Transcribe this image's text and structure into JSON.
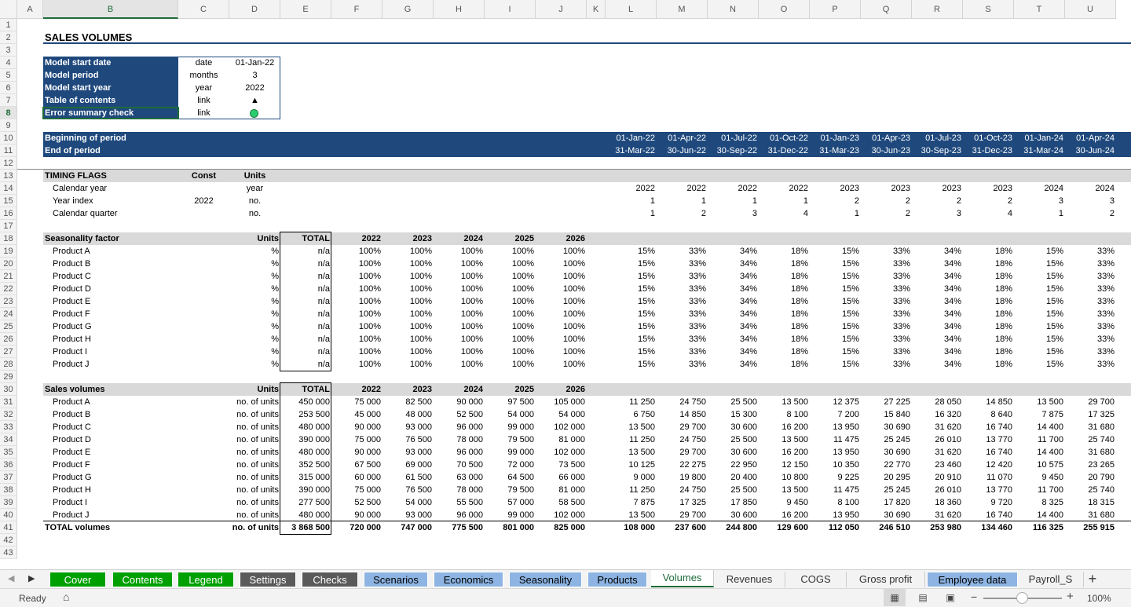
{
  "columns": [
    "A",
    "B",
    "C",
    "D",
    "E",
    "F",
    "G",
    "H",
    "I",
    "J",
    "K",
    "L",
    "M",
    "N",
    "O",
    "P",
    "Q",
    "R",
    "S",
    "T",
    "U"
  ],
  "rows": [
    "1",
    "2",
    "3",
    "4",
    "5",
    "6",
    "7",
    "8",
    "9",
    "10",
    "11",
    "12",
    "13",
    "14",
    "15",
    "16",
    "17",
    "18",
    "19",
    "20",
    "21",
    "22",
    "23",
    "24",
    "25",
    "26",
    "27",
    "28",
    "29",
    "30",
    "31",
    "32",
    "33",
    "34",
    "35",
    "36",
    "37",
    "38",
    "39",
    "40",
    "41",
    "42",
    "43"
  ],
  "title": "SALES VOLUMES",
  "model_info": [
    {
      "label": "Model start date",
      "unit": "date",
      "value": "01-Jan-22"
    },
    {
      "label": "Model period",
      "unit": "months",
      "value": "3"
    },
    {
      "label": "Model start year",
      "unit": "year",
      "value": "2022"
    },
    {
      "label": "Table of contents",
      "unit": "link",
      "value": "▲"
    },
    {
      "label": "Error summary check",
      "unit": "link",
      "value": ""
    }
  ],
  "period": {
    "begin_label": "Beginning of period",
    "end_label": "End of period",
    "begin": [
      "01-Jan-22",
      "01-Apr-22",
      "01-Jul-22",
      "01-Oct-22",
      "01-Jan-23",
      "01-Apr-23",
      "01-Jul-23",
      "01-Oct-23",
      "01-Jan-24",
      "01-Apr-24"
    ],
    "end": [
      "31-Mar-22",
      "30-Jun-22",
      "30-Sep-22",
      "31-Dec-22",
      "31-Mar-23",
      "30-Jun-23",
      "30-Sep-23",
      "31-Dec-23",
      "31-Mar-24",
      "30-Jun-24"
    ]
  },
  "timing": {
    "header": "TIMING FLAGS",
    "const_hdr": "Const",
    "units_hdr": "Units",
    "rows": [
      {
        "label": "Calendar year",
        "const": "",
        "units": "year",
        "values": [
          "2022",
          "2022",
          "2022",
          "2022",
          "2023",
          "2023",
          "2023",
          "2023",
          "2024",
          "2024"
        ]
      },
      {
        "label": "Year index",
        "const": "2022",
        "units": "no.",
        "values": [
          "1",
          "1",
          "1",
          "1",
          "2",
          "2",
          "2",
          "2",
          "3",
          "3"
        ]
      },
      {
        "label": "Calendar quarter",
        "const": "",
        "units": "no.",
        "values": [
          "1",
          "2",
          "3",
          "4",
          "1",
          "2",
          "3",
          "4",
          "1",
          "2"
        ]
      }
    ]
  },
  "seasonality": {
    "header": "Seasonality factor",
    "units_hdr": "Units",
    "total_hdr": "TOTAL",
    "years": [
      "2022",
      "2023",
      "2024",
      "2025",
      "2026"
    ],
    "products": [
      "Product A",
      "Product B",
      "Product C",
      "Product D",
      "Product E",
      "Product F",
      "Product G",
      "Product H",
      "Product I",
      "Product J"
    ],
    "units": "%",
    "total": "n/a",
    "annual": "100%",
    "quarters": [
      "15%",
      "33%",
      "34%",
      "18%",
      "15%",
      "33%",
      "34%",
      "18%",
      "15%",
      "33%"
    ]
  },
  "volumes": {
    "header": "Sales volumes",
    "units_hdr": "Units",
    "total_hdr": "TOTAL",
    "years": [
      "2022",
      "2023",
      "2024",
      "2025",
      "2026"
    ],
    "units": "no. of units",
    "rows": [
      {
        "label": "Product A",
        "total": "450 000",
        "annual": [
          "75 000",
          "82 500",
          "90 000",
          "97 500",
          "105 000"
        ],
        "q": [
          "11 250",
          "24 750",
          "25 500",
          "13 500",
          "12 375",
          "27 225",
          "28 050",
          "14 850",
          "13 500",
          "29 700"
        ]
      },
      {
        "label": "Product B",
        "total": "253 500",
        "annual": [
          "45 000",
          "48 000",
          "52 500",
          "54 000",
          "54 000"
        ],
        "q": [
          "6 750",
          "14 850",
          "15 300",
          "8 100",
          "7 200",
          "15 840",
          "16 320",
          "8 640",
          "7 875",
          "17 325"
        ]
      },
      {
        "label": "Product C",
        "total": "480 000",
        "annual": [
          "90 000",
          "93 000",
          "96 000",
          "99 000",
          "102 000"
        ],
        "q": [
          "13 500",
          "29 700",
          "30 600",
          "16 200",
          "13 950",
          "30 690",
          "31 620",
          "16 740",
          "14 400",
          "31 680"
        ]
      },
      {
        "label": "Product D",
        "total": "390 000",
        "annual": [
          "75 000",
          "76 500",
          "78 000",
          "79 500",
          "81 000"
        ],
        "q": [
          "11 250",
          "24 750",
          "25 500",
          "13 500",
          "11 475",
          "25 245",
          "26 010",
          "13 770",
          "11 700",
          "25 740"
        ]
      },
      {
        "label": "Product E",
        "total": "480 000",
        "annual": [
          "90 000",
          "93 000",
          "96 000",
          "99 000",
          "102 000"
        ],
        "q": [
          "13 500",
          "29 700",
          "30 600",
          "16 200",
          "13 950",
          "30 690",
          "31 620",
          "16 740",
          "14 400",
          "31 680"
        ]
      },
      {
        "label": "Product F",
        "total": "352 500",
        "annual": [
          "67 500",
          "69 000",
          "70 500",
          "72 000",
          "73 500"
        ],
        "q": [
          "10 125",
          "22 275",
          "22 950",
          "12 150",
          "10 350",
          "22 770",
          "23 460",
          "12 420",
          "10 575",
          "23 265"
        ]
      },
      {
        "label": "Product G",
        "total": "315 000",
        "annual": [
          "60 000",
          "61 500",
          "63 000",
          "64 500",
          "66 000"
        ],
        "q": [
          "9 000",
          "19 800",
          "20 400",
          "10 800",
          "9 225",
          "20 295",
          "20 910",
          "11 070",
          "9 450",
          "20 790"
        ]
      },
      {
        "label": "Product H",
        "total": "390 000",
        "annual": [
          "75 000",
          "76 500",
          "78 000",
          "79 500",
          "81 000"
        ],
        "q": [
          "11 250",
          "24 750",
          "25 500",
          "13 500",
          "11 475",
          "25 245",
          "26 010",
          "13 770",
          "11 700",
          "25 740"
        ]
      },
      {
        "label": "Product I",
        "total": "277 500",
        "annual": [
          "52 500",
          "54 000",
          "55 500",
          "57 000",
          "58 500"
        ],
        "q": [
          "7 875",
          "17 325",
          "17 850",
          "9 450",
          "8 100",
          "17 820",
          "18 360",
          "9 720",
          "8 325",
          "18 315"
        ]
      },
      {
        "label": "Product J",
        "total": "480 000",
        "annual": [
          "90 000",
          "93 000",
          "96 000",
          "99 000",
          "102 000"
        ],
        "q": [
          "13 500",
          "29 700",
          "30 600",
          "16 200",
          "13 950",
          "30 690",
          "31 620",
          "16 740",
          "14 400",
          "31 680"
        ]
      }
    ],
    "total_row": {
      "label": "TOTAL volumes",
      "units": "no. of units",
      "total": "3 868 500",
      "annual": [
        "720 000",
        "747 000",
        "775 500",
        "801 000",
        "825 000"
      ],
      "q": [
        "108 000",
        "237 600",
        "244 800",
        "129 600",
        "112 050",
        "246 510",
        "253 980",
        "134 460",
        "116 325",
        "255 915"
      ]
    }
  },
  "tabs": [
    {
      "label": "Cover",
      "style": "green"
    },
    {
      "label": "Contents",
      "style": "green"
    },
    {
      "label": "Legend",
      "style": "green"
    },
    {
      "label": "Settings",
      "style": "grey"
    },
    {
      "label": "Checks",
      "style": "grey"
    },
    {
      "label": "Scenarios",
      "style": "lblue"
    },
    {
      "label": "Economics",
      "style": "lblue"
    },
    {
      "label": "Seasonality",
      "style": "lblue"
    },
    {
      "label": "Products",
      "style": "lblue"
    },
    {
      "label": "Volumes",
      "style": "active"
    },
    {
      "label": "Revenues",
      "style": "plain"
    },
    {
      "label": "COGS",
      "style": "plain"
    },
    {
      "label": "Gross profit",
      "style": "plain"
    },
    {
      "label": "Employee data",
      "style": "lblue"
    },
    {
      "label": "Payroll_S",
      "style": "plain"
    }
  ],
  "add_sheet": "+",
  "status": {
    "ready": "Ready",
    "zoom": "100%"
  },
  "colors": {
    "navy": "#1f497d",
    "green_tab": "#00a000",
    "grey_tab": "#5a5a5a",
    "blue_tab": "#8db4e2",
    "excel_green": "#1e6b3a",
    "status_ok": "#2ecc71"
  }
}
